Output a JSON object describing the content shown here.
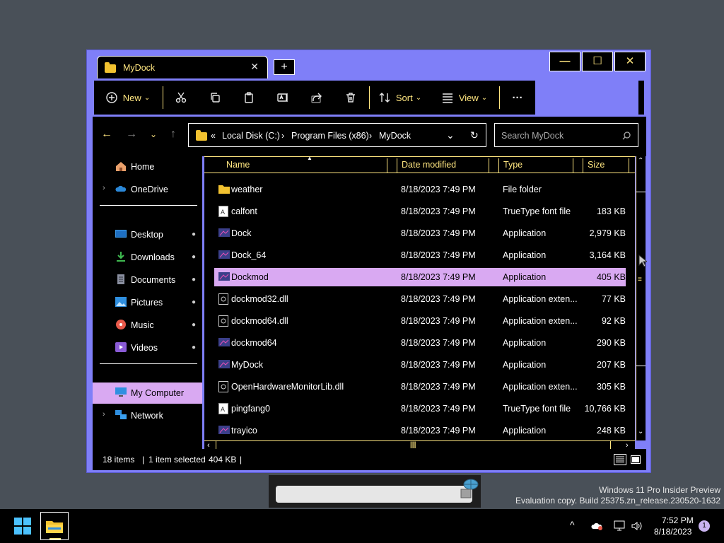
{
  "window": {
    "tab_title": "MyDock",
    "tab_close": "✕",
    "new_tab": "+",
    "minimize": "—",
    "maximize": "☐",
    "close": "✕"
  },
  "toolbar": {
    "new_label": "New",
    "sort_label": "Sort",
    "view_label": "View",
    "more": "···",
    "chevron": "⌄"
  },
  "nav": {
    "back": "←",
    "forward": "→",
    "recent": "⌄",
    "up": "↑",
    "refresh": "↻"
  },
  "address": {
    "overflow": "«",
    "crumbs": [
      "Local Disk (C:)",
      "Program Files (x86)",
      "MyDock"
    ],
    "sep": "›",
    "dropdown": "⌄"
  },
  "search": {
    "placeholder": "Search MyDock"
  },
  "navpane": {
    "items": [
      {
        "label": "Home"
      },
      {
        "label": "OneDrive"
      },
      {
        "label": "Desktop"
      },
      {
        "label": "Downloads"
      },
      {
        "label": "Documents"
      },
      {
        "label": "Pictures"
      },
      {
        "label": "Music"
      },
      {
        "label": "Videos"
      },
      {
        "label": "My Computer"
      },
      {
        "label": "Network"
      }
    ],
    "chevron": "›",
    "pin": "📌"
  },
  "columns": [
    "Name",
    "Date modified",
    "Type",
    "Size"
  ],
  "files": [
    {
      "name": "weather",
      "date": "8/18/2023 7:49 PM",
      "type": "File folder",
      "size": ""
    },
    {
      "name": "calfont",
      "date": "8/18/2023 7:49 PM",
      "type": "TrueType font file",
      "size": "183 KB"
    },
    {
      "name": "Dock",
      "date": "8/18/2023 7:49 PM",
      "type": "Application",
      "size": "2,979 KB"
    },
    {
      "name": "Dock_64",
      "date": "8/18/2023 7:49 PM",
      "type": "Application",
      "size": "3,164 KB"
    },
    {
      "name": "Dockmod",
      "date": "8/18/2023 7:49 PM",
      "type": "Application",
      "size": "405 KB"
    },
    {
      "name": "dockmod32.dll",
      "date": "8/18/2023 7:49 PM",
      "type": "Application exten...",
      "size": "77 KB"
    },
    {
      "name": "dockmod64.dll",
      "date": "8/18/2023 7:49 PM",
      "type": "Application exten...",
      "size": "92 KB"
    },
    {
      "name": "dockmod64",
      "date": "8/18/2023 7:49 PM",
      "type": "Application",
      "size": "290 KB"
    },
    {
      "name": "MyDock",
      "date": "8/18/2023 7:49 PM",
      "type": "Application",
      "size": "207 KB"
    },
    {
      "name": "OpenHardwareMonitorLib.dll",
      "date": "8/18/2023 7:49 PM",
      "type": "Application exten...",
      "size": "305 KB"
    },
    {
      "name": "pingfang0",
      "date": "8/18/2023 7:49 PM",
      "type": "TrueType font file",
      "size": "10,766 KB"
    },
    {
      "name": "trayico",
      "date": "8/18/2023 7:49 PM",
      "type": "Application",
      "size": "248 KB"
    }
  ],
  "status": {
    "items_count": "18 items",
    "selected": "1 item selected",
    "selected_size": "404 KB"
  },
  "watermark": {
    "line1": "Windows 11 Pro Insider Preview",
    "line2": "Evaluation copy. Build 25375.zn_release.230520-1632"
  },
  "taskbar": {
    "time": "7:52 PM",
    "date": "8/18/2023",
    "notification_count": "1",
    "tray_chevron": "^"
  },
  "colors": {
    "accent": "#7f7ff8",
    "highlight": "#d9a9f2",
    "text_yellow": "#ffe680"
  }
}
